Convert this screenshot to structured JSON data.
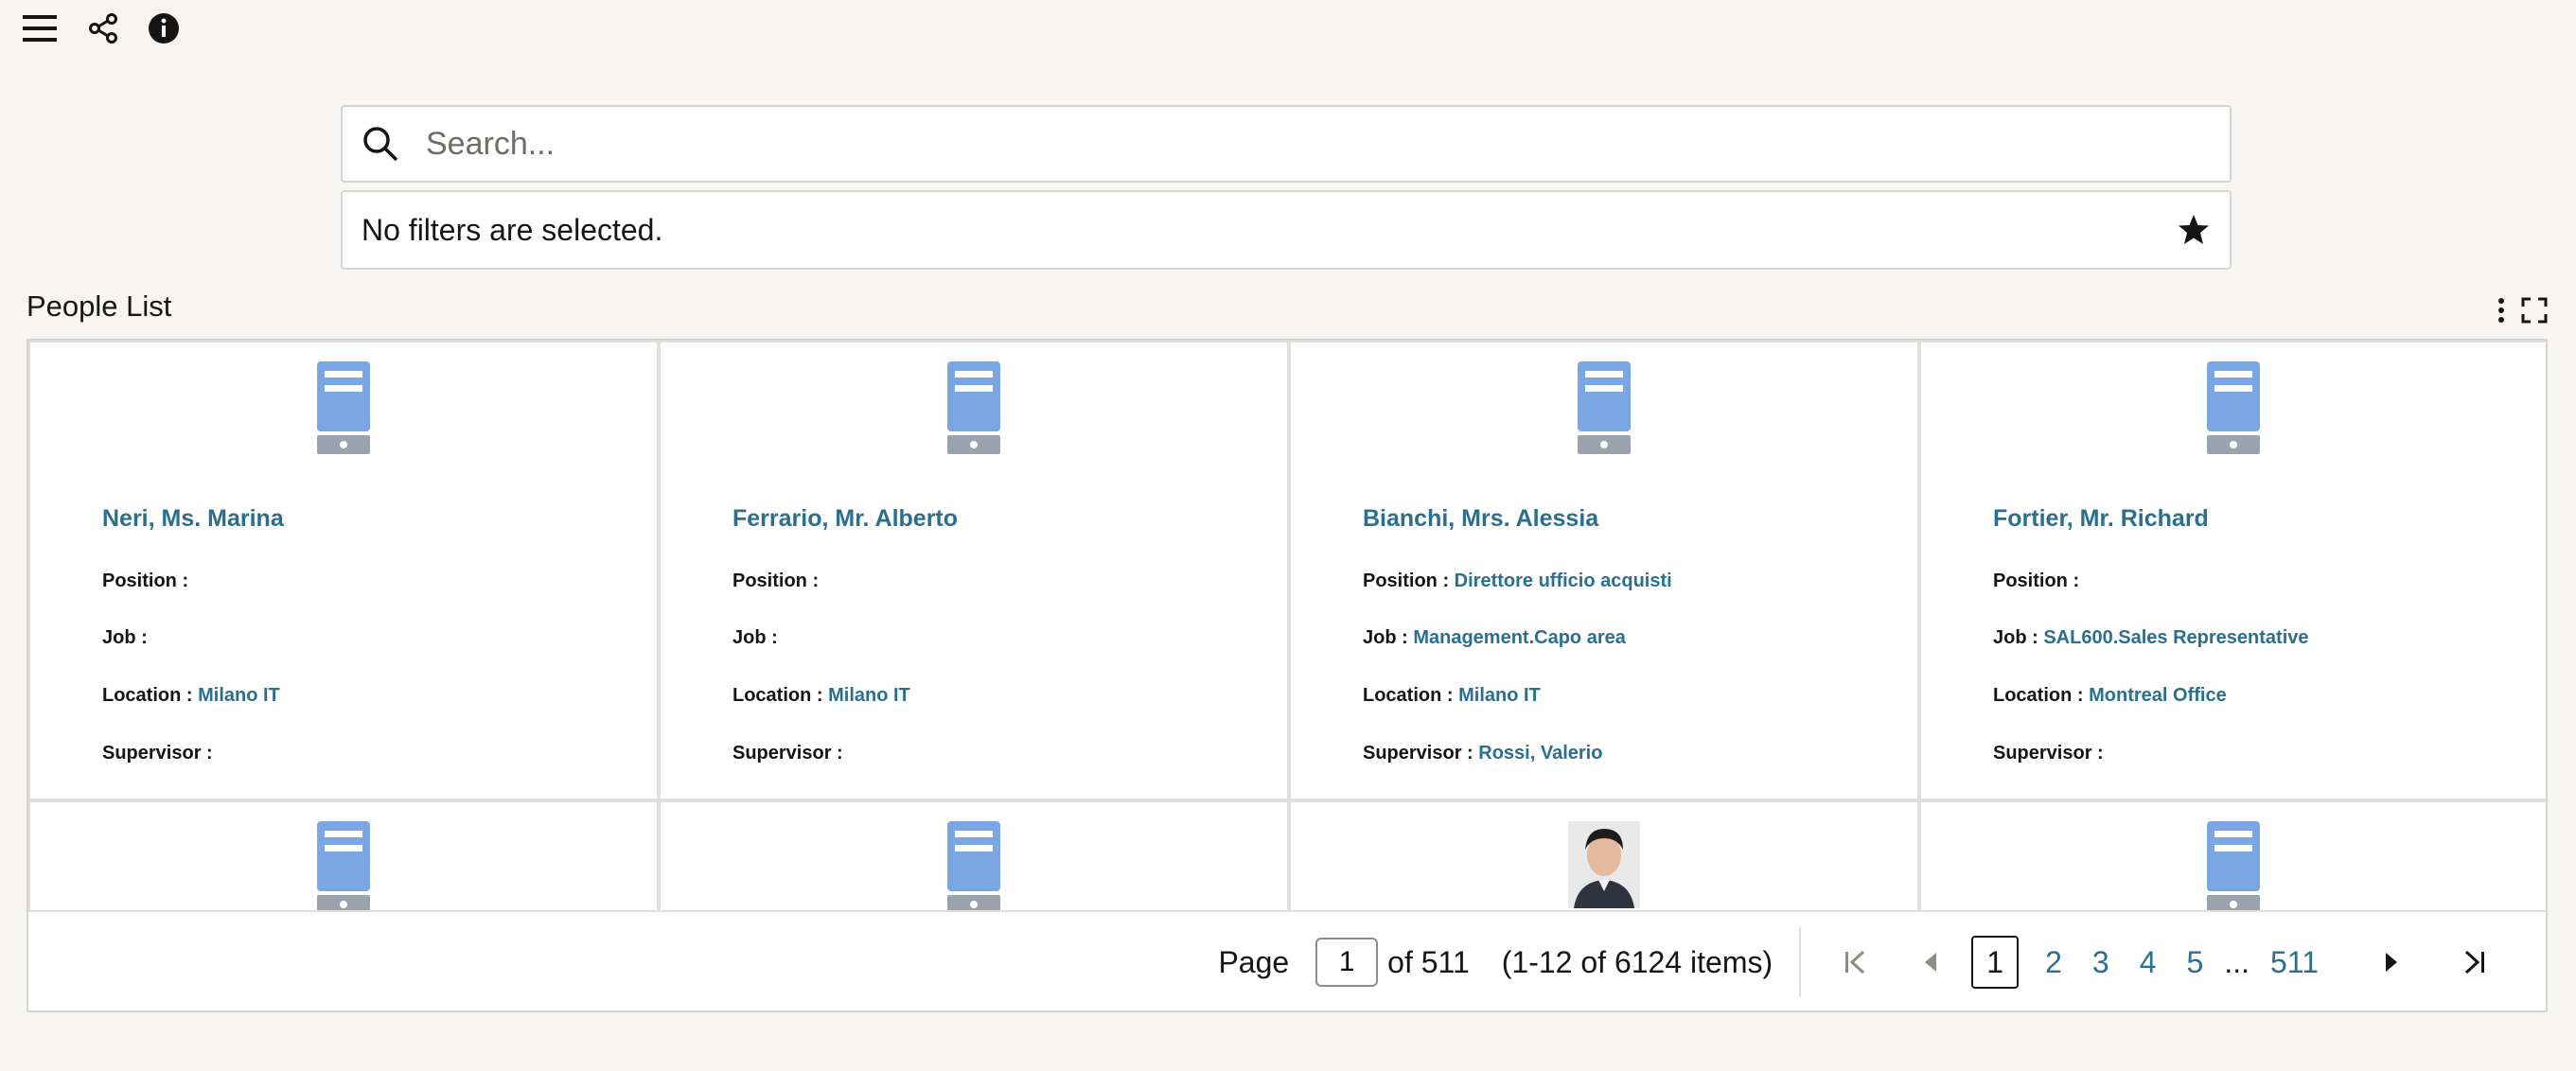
{
  "toolbar": {
    "icons": [
      "menu-icon",
      "share-icon",
      "info-icon"
    ]
  },
  "search": {
    "placeholder": "Search...",
    "value": ""
  },
  "filters": {
    "text": "No filters are selected."
  },
  "list": {
    "title": "People List"
  },
  "people": [
    {
      "name": "Neri, Ms. Marina",
      "position_label": "Position :",
      "position": "",
      "job_label": "Job :",
      "job": "",
      "location_label": "Location :",
      "location": "Milano IT",
      "supervisor_label": "Supervisor :",
      "supervisor": ""
    },
    {
      "name": "Ferrario, Mr. Alberto",
      "position_label": "Position :",
      "position": "",
      "job_label": "Job :",
      "job": "",
      "location_label": "Location :",
      "location": "Milano IT",
      "supervisor_label": "Supervisor :",
      "supervisor": ""
    },
    {
      "name": "Bianchi, Mrs. Alessia",
      "position_label": "Position :",
      "position": "Direttore ufficio acquisti",
      "job_label": "Job :",
      "job": "Management.Capo area",
      "location_label": "Location :",
      "location": "Milano IT",
      "supervisor_label": "Supervisor :",
      "supervisor": "Rossi, Valerio"
    },
    {
      "name": "Fortier, Mr. Richard",
      "position_label": "Position :",
      "position": "",
      "job_label": "Job :",
      "job": "SAL600.Sales Representative",
      "location_label": "Location :",
      "location": "Montreal Office",
      "supervisor_label": "Supervisor :",
      "supervisor": ""
    }
  ],
  "pager": {
    "page_label": "Page",
    "current_page": "1",
    "of_label": "of 511",
    "range_label": "(1-12 of 6124 items)",
    "pages": [
      "1",
      "2",
      "3",
      "4",
      "5"
    ],
    "ellipsis": "...",
    "last_page": "511"
  },
  "colors": {
    "link": "#2a6f8f",
    "avatar_blue": "#7aa7e3",
    "avatar_gray": "#9aa3ad",
    "background": "#f6f5f3"
  }
}
